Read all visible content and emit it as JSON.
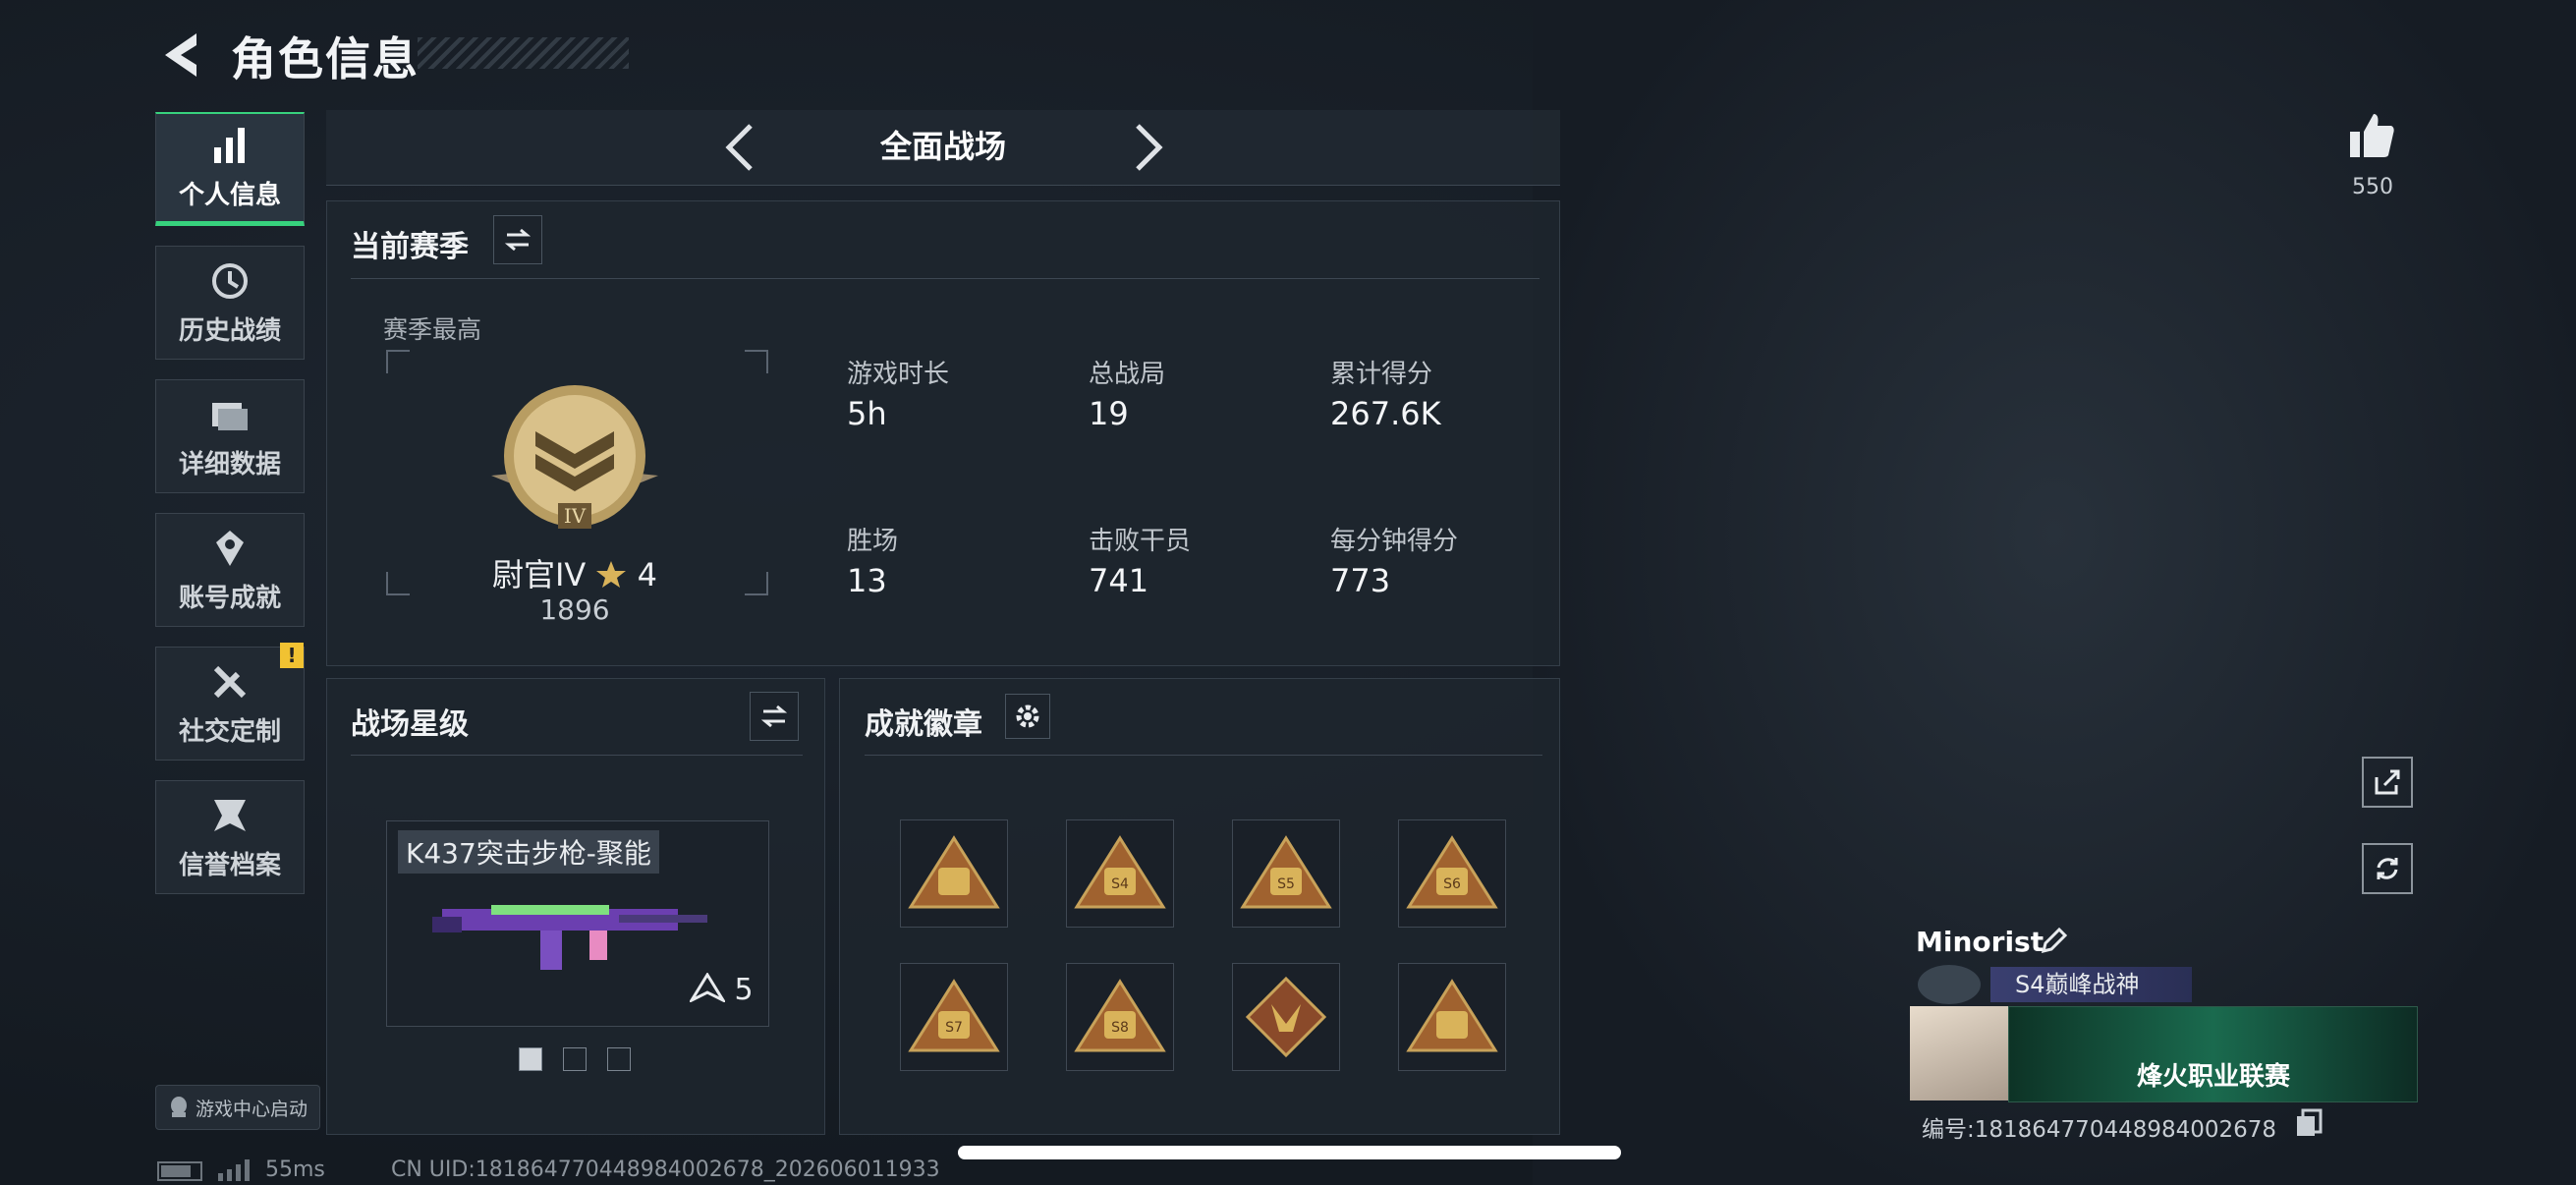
{
  "header": {
    "title": "角色信息"
  },
  "nav": {
    "items": [
      {
        "label": "个人信息"
      },
      {
        "label": "历史战绩"
      },
      {
        "label": "详细数据"
      },
      {
        "label": "账号成就"
      },
      {
        "label": "社交定制",
        "badge": "!"
      },
      {
        "label": "信誉档案"
      }
    ],
    "launch_label": "游戏中心启动"
  },
  "mode": {
    "label": "全面战场"
  },
  "season": {
    "title": "当前赛季",
    "best_label": "赛季最高",
    "rank_name": "尉官IV",
    "rank_stars": "4",
    "rank_score": "1896",
    "rank_emblem_text": "IV",
    "stats": [
      {
        "label": "游戏时长",
        "value": "5h"
      },
      {
        "label": "总战局",
        "value": "19"
      },
      {
        "label": "累计得分",
        "value": "267.6K"
      },
      {
        "label": "胜场",
        "value": "13"
      },
      {
        "label": "击败干员",
        "value": "741"
      },
      {
        "label": "每分钟得分",
        "value": "773"
      }
    ]
  },
  "battle_star": {
    "title": "战场星级",
    "weapon_name": "K437突击步枪-聚能",
    "weapon_level": "5"
  },
  "achievements": {
    "title": "成就徽章",
    "badges": [
      "",
      "S4",
      "S5",
      "S6",
      "S7",
      "S8",
      "",
      ""
    ]
  },
  "profile": {
    "likes": "550",
    "player_name": "Minorist",
    "title_text": "S4巅峰战神",
    "banner_text": "烽火职业联赛",
    "id_text": "编号:18186477044898400267​8"
  },
  "footer": {
    "ping": "55ms",
    "uid": "CN UID:18186477044898400267​8_202606011933"
  },
  "colors": {
    "accent_green": "#37d27d",
    "warning": "#f1c232",
    "medal_gold": "#c8a25a"
  }
}
